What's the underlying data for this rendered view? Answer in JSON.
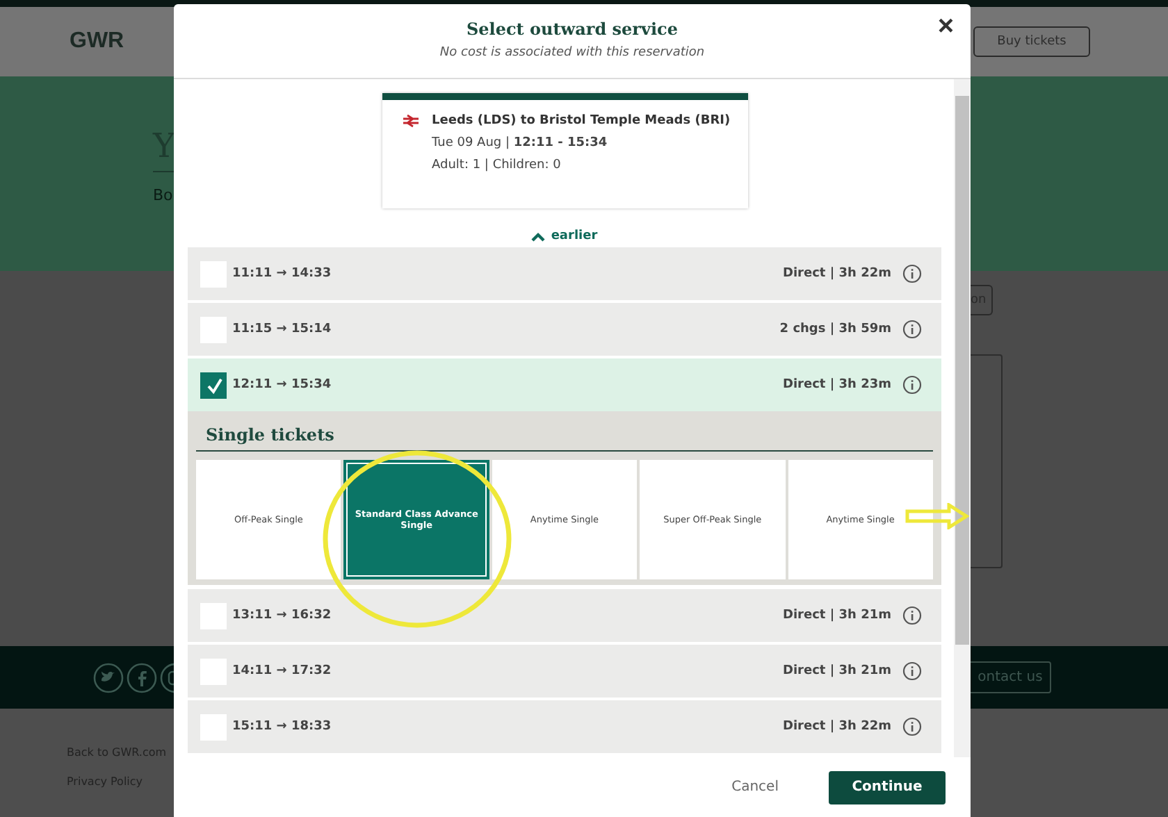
{
  "page": {
    "logo": "GWR",
    "header_button": "Buy tickets",
    "heading": "Y",
    "intro": "Bo",
    "side_button": "on",
    "contact_button": "ontact us",
    "footer_links": [
      "Back to GWR.com",
      "Privacy Policy"
    ]
  },
  "dialog": {
    "title": "Select outward service",
    "subtitle": "No cost is associated with this reservation",
    "close": "×",
    "journey": {
      "route": "Leeds (LDS) to Bristol Temple Meads (BRI)",
      "date": "Tue 09 Aug | **12:11 - 15:34**",
      "passengers": "Adult: 1 | Children: 0"
    },
    "earlier": "earlier",
    "services": [
      {
        "times": "11:11 → 14:33",
        "info": "Direct | 3h 22m",
        "selected": false
      },
      {
        "times": "11:15 → 15:14",
        "info": "2 chgs | 3h 59m",
        "selected": false
      },
      {
        "times": "12:11 → 15:34",
        "info": "Direct | 3h 23m",
        "selected": true,
        "tickets": {
          "heading": "Single tickets",
          "options": [
            {
              "label": "Off-Peak Single",
              "selected": false
            },
            {
              "label": "Standard Class Advance Single",
              "selected": true
            },
            {
              "label": "Anytime Single",
              "selected": false
            },
            {
              "label": "Super Off-Peak Single",
              "selected": false
            },
            {
              "label": "Anytime Single",
              "selected": false
            }
          ]
        }
      },
      {
        "times": "13:11 → 16:32",
        "info": "Direct | 3h 21m",
        "selected": false
      },
      {
        "times": "14:11 → 17:32",
        "info": "Direct | 3h 21m",
        "selected": false
      },
      {
        "times": "15:11 → 18:33",
        "info": "Direct | 3h 22m",
        "selected": false
      }
    ],
    "buttons": [
      {
        "label": "Cancel",
        "kind": "secondary"
      },
      {
        "label": "Continue",
        "kind": "primary"
      }
    ]
  }
}
